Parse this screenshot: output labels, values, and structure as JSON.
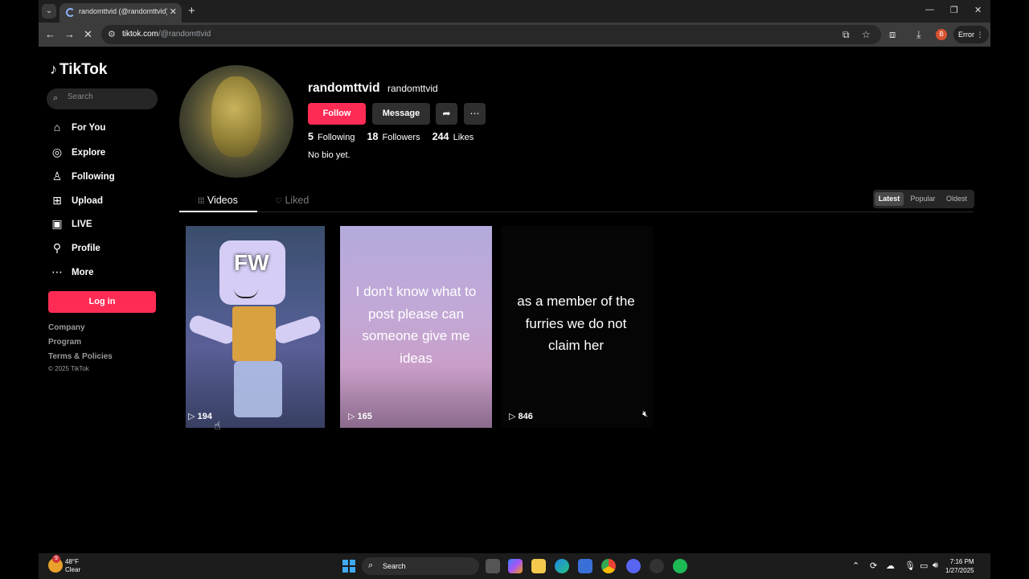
{
  "browser": {
    "tab_title": "randomttvid (@randomttvid) | TikTok",
    "url_host": "tiktok.com",
    "url_path": "/@randomttvid",
    "error_label": "Error",
    "profile_initial": "B"
  },
  "sidebar": {
    "brand": "TikTok",
    "search_placeholder": "Search",
    "items": [
      {
        "label": "For You",
        "icon": "home-icon"
      },
      {
        "label": "Explore",
        "icon": "compass-icon"
      },
      {
        "label": "Following",
        "icon": "following-icon"
      },
      {
        "label": "Upload",
        "icon": "upload-icon"
      },
      {
        "label": "LIVE",
        "icon": "live-icon"
      },
      {
        "label": "Profile",
        "icon": "profile-icon"
      },
      {
        "label": "More",
        "icon": "more-icon"
      }
    ],
    "login_label": "Log in",
    "footer_links": [
      "Company",
      "Program",
      "Terms & Policies"
    ],
    "copyright": "© 2025 TikTok"
  },
  "profile": {
    "username": "randomttvid",
    "nickname": "randomttvid",
    "follow_label": "Follow",
    "message_label": "Message",
    "following_count": "5",
    "following_label": "Following",
    "followers_count": "18",
    "followers_label": "Followers",
    "likes_count": "244",
    "likes_label": "Likes",
    "bio": "No bio yet."
  },
  "tabs": {
    "videos": "Videos",
    "liked": "Liked"
  },
  "sort": {
    "options": [
      "Latest",
      "Popular",
      "Oldest"
    ],
    "selected": "Latest"
  },
  "videos": [
    {
      "views": "194",
      "overlay": "FW",
      "caption": ""
    },
    {
      "views": "165",
      "caption": "I don't know what to post please can someone give me ideas"
    },
    {
      "views": "846",
      "caption": "as a member of the furries we do not claim her"
    }
  ],
  "taskbar": {
    "weather_temp": "48°F",
    "weather_desc": "Clear",
    "weather_badge": "9",
    "search_label": "Search",
    "time": "7:16 PM",
    "date": "1/27/2025"
  },
  "colors": {
    "accent": "#fe2c55",
    "background": "#000000"
  }
}
